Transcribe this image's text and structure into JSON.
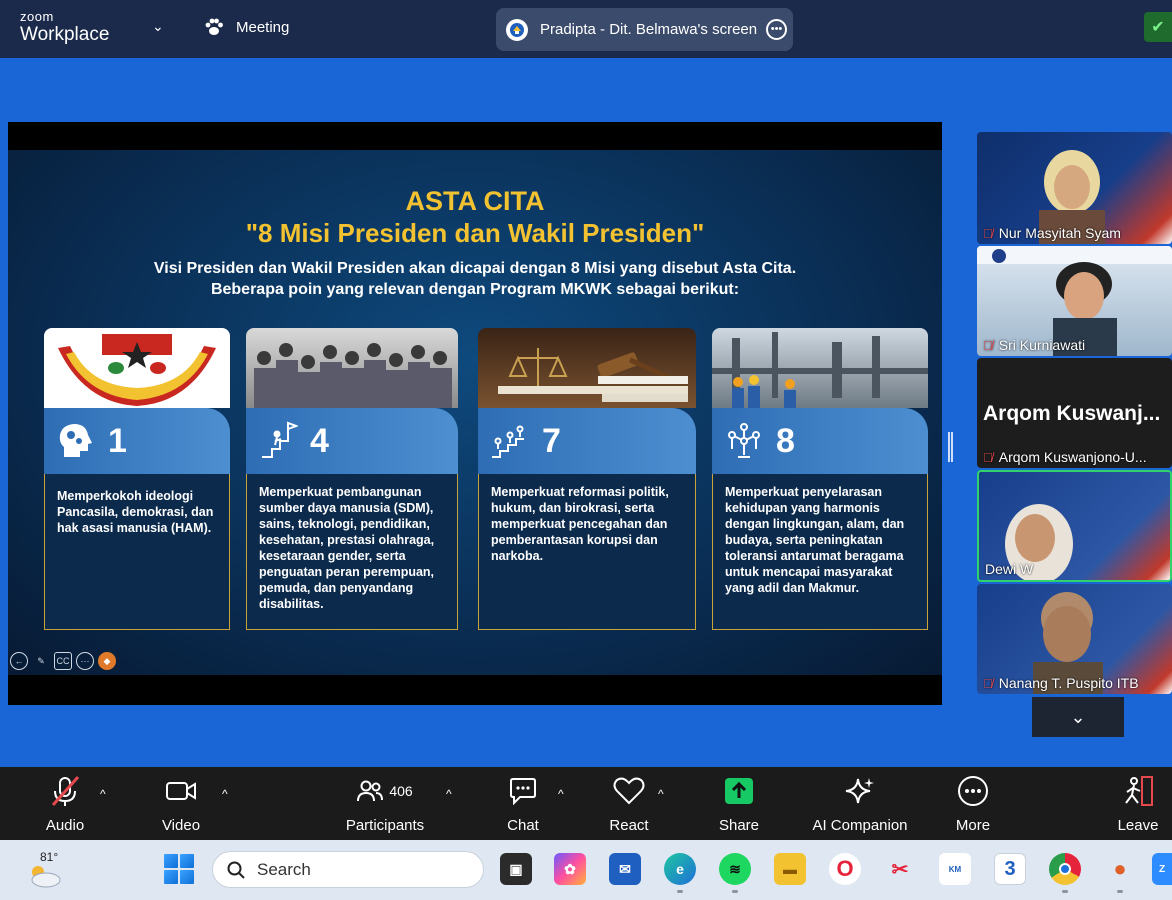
{
  "topbar": {
    "logo_line1": "zoom",
    "logo_line2": "Workplace",
    "meeting_label": "Meeting",
    "share_label": "Pradipta - Dit. Belmawa's screen"
  },
  "slide": {
    "title_line1": "ASTA CITA",
    "title_line2": "\"8 Misi Presiden dan Wakil Presiden\"",
    "subtitle_line1": "Visi Presiden dan Wakil Presiden akan dicapai dengan 8 Misi yang disebut Asta Cita.",
    "subtitle_line2": "Beberapa poin yang relevan dengan Program MKWK sebagai berikut:",
    "cards": [
      {
        "number": "1",
        "icon": "head-gears-icon",
        "text": "Memperkokoh ideologi Pancasila, demokrasi, dan hak asasi manusia (HAM)."
      },
      {
        "number": "4",
        "icon": "climb-flag-icon",
        "text": "Memperkuat pembangunan sumber daya manusia (SDM), sains, teknologi, pendidikan, kesehatan, prestasi olahraga, kesetaraan gender, serta penguatan peran perempuan, pemuda, dan penyandang disabilitas."
      },
      {
        "number": "7",
        "icon": "stairs-people-icon",
        "text": "Memperkuat reformasi politik, hukum, dan birokrasi, serta memperkuat pencegahan dan pemberantasan korupsi dan narkoba."
      },
      {
        "number": "8",
        "icon": "people-network-icon",
        "text": "Memperkuat penyelarasan kehidupan yang harmonis dengan lingkungan, alam, dan budaya, serta peningkatan toleransi antarumat beragama untuk mencapai masyarakat yang adil dan Makmur."
      }
    ]
  },
  "participants": [
    {
      "name": "Nur Masyitah Syam",
      "muted": true
    },
    {
      "name": "Sri Kurniawati",
      "muted": true
    },
    {
      "name": "Arqom Kuswanjono-U...",
      "big_label": "Arqom Kuswanj...",
      "muted": true
    },
    {
      "name": "Dewi W",
      "muted": false
    },
    {
      "name": "Nanang T. Puspito ITB",
      "muted": true
    }
  ],
  "toolbar": {
    "audio": "Audio",
    "video": "Video",
    "participants": "Participants",
    "participants_count": "406",
    "chat": "Chat",
    "react": "React",
    "share": "Share",
    "ai_companion": "AI Companion",
    "more": "More",
    "leave": "Leave"
  },
  "taskbar": {
    "weather_temp": "81°",
    "search_placeholder": "Search"
  },
  "colors": {
    "slide_accent": "#f2c230",
    "card_head": "#3a7cc4",
    "card_border": "#c9a23a",
    "share_green": "#17c964",
    "mute_red": "#e5484d"
  }
}
